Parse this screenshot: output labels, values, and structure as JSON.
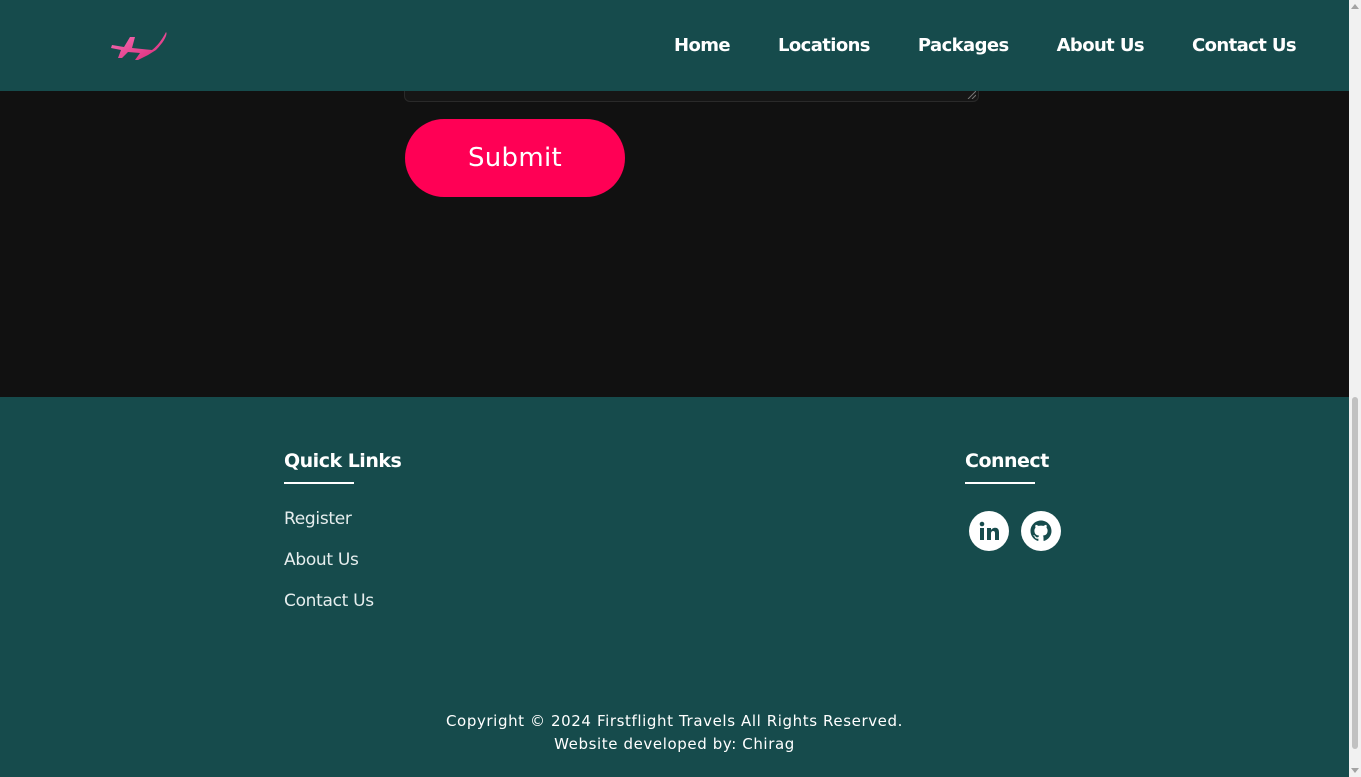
{
  "nav": {
    "items": [
      {
        "label": "Home"
      },
      {
        "label": "Locations"
      },
      {
        "label": "Packages"
      },
      {
        "label": "About Us"
      },
      {
        "label": "Contact Us"
      }
    ]
  },
  "form": {
    "submit_label": "Submit"
  },
  "footer": {
    "quick_links": {
      "title": "Quick Links",
      "items": [
        {
          "label": "Register"
        },
        {
          "label": "About Us"
        },
        {
          "label": "Contact Us"
        }
      ]
    },
    "connect": {
      "title": "Connect",
      "icons": [
        "linkedin-icon",
        "github-icon"
      ]
    },
    "copyright": "Copyright © 2024 Firstflight Travels All Rights Reserved.",
    "developer": "Website developed by: Chirag"
  },
  "colors": {
    "header_bg": "#164b4c",
    "accent": "#ff0055",
    "logo": "#f25fa4",
    "body_bg": "#111111"
  }
}
